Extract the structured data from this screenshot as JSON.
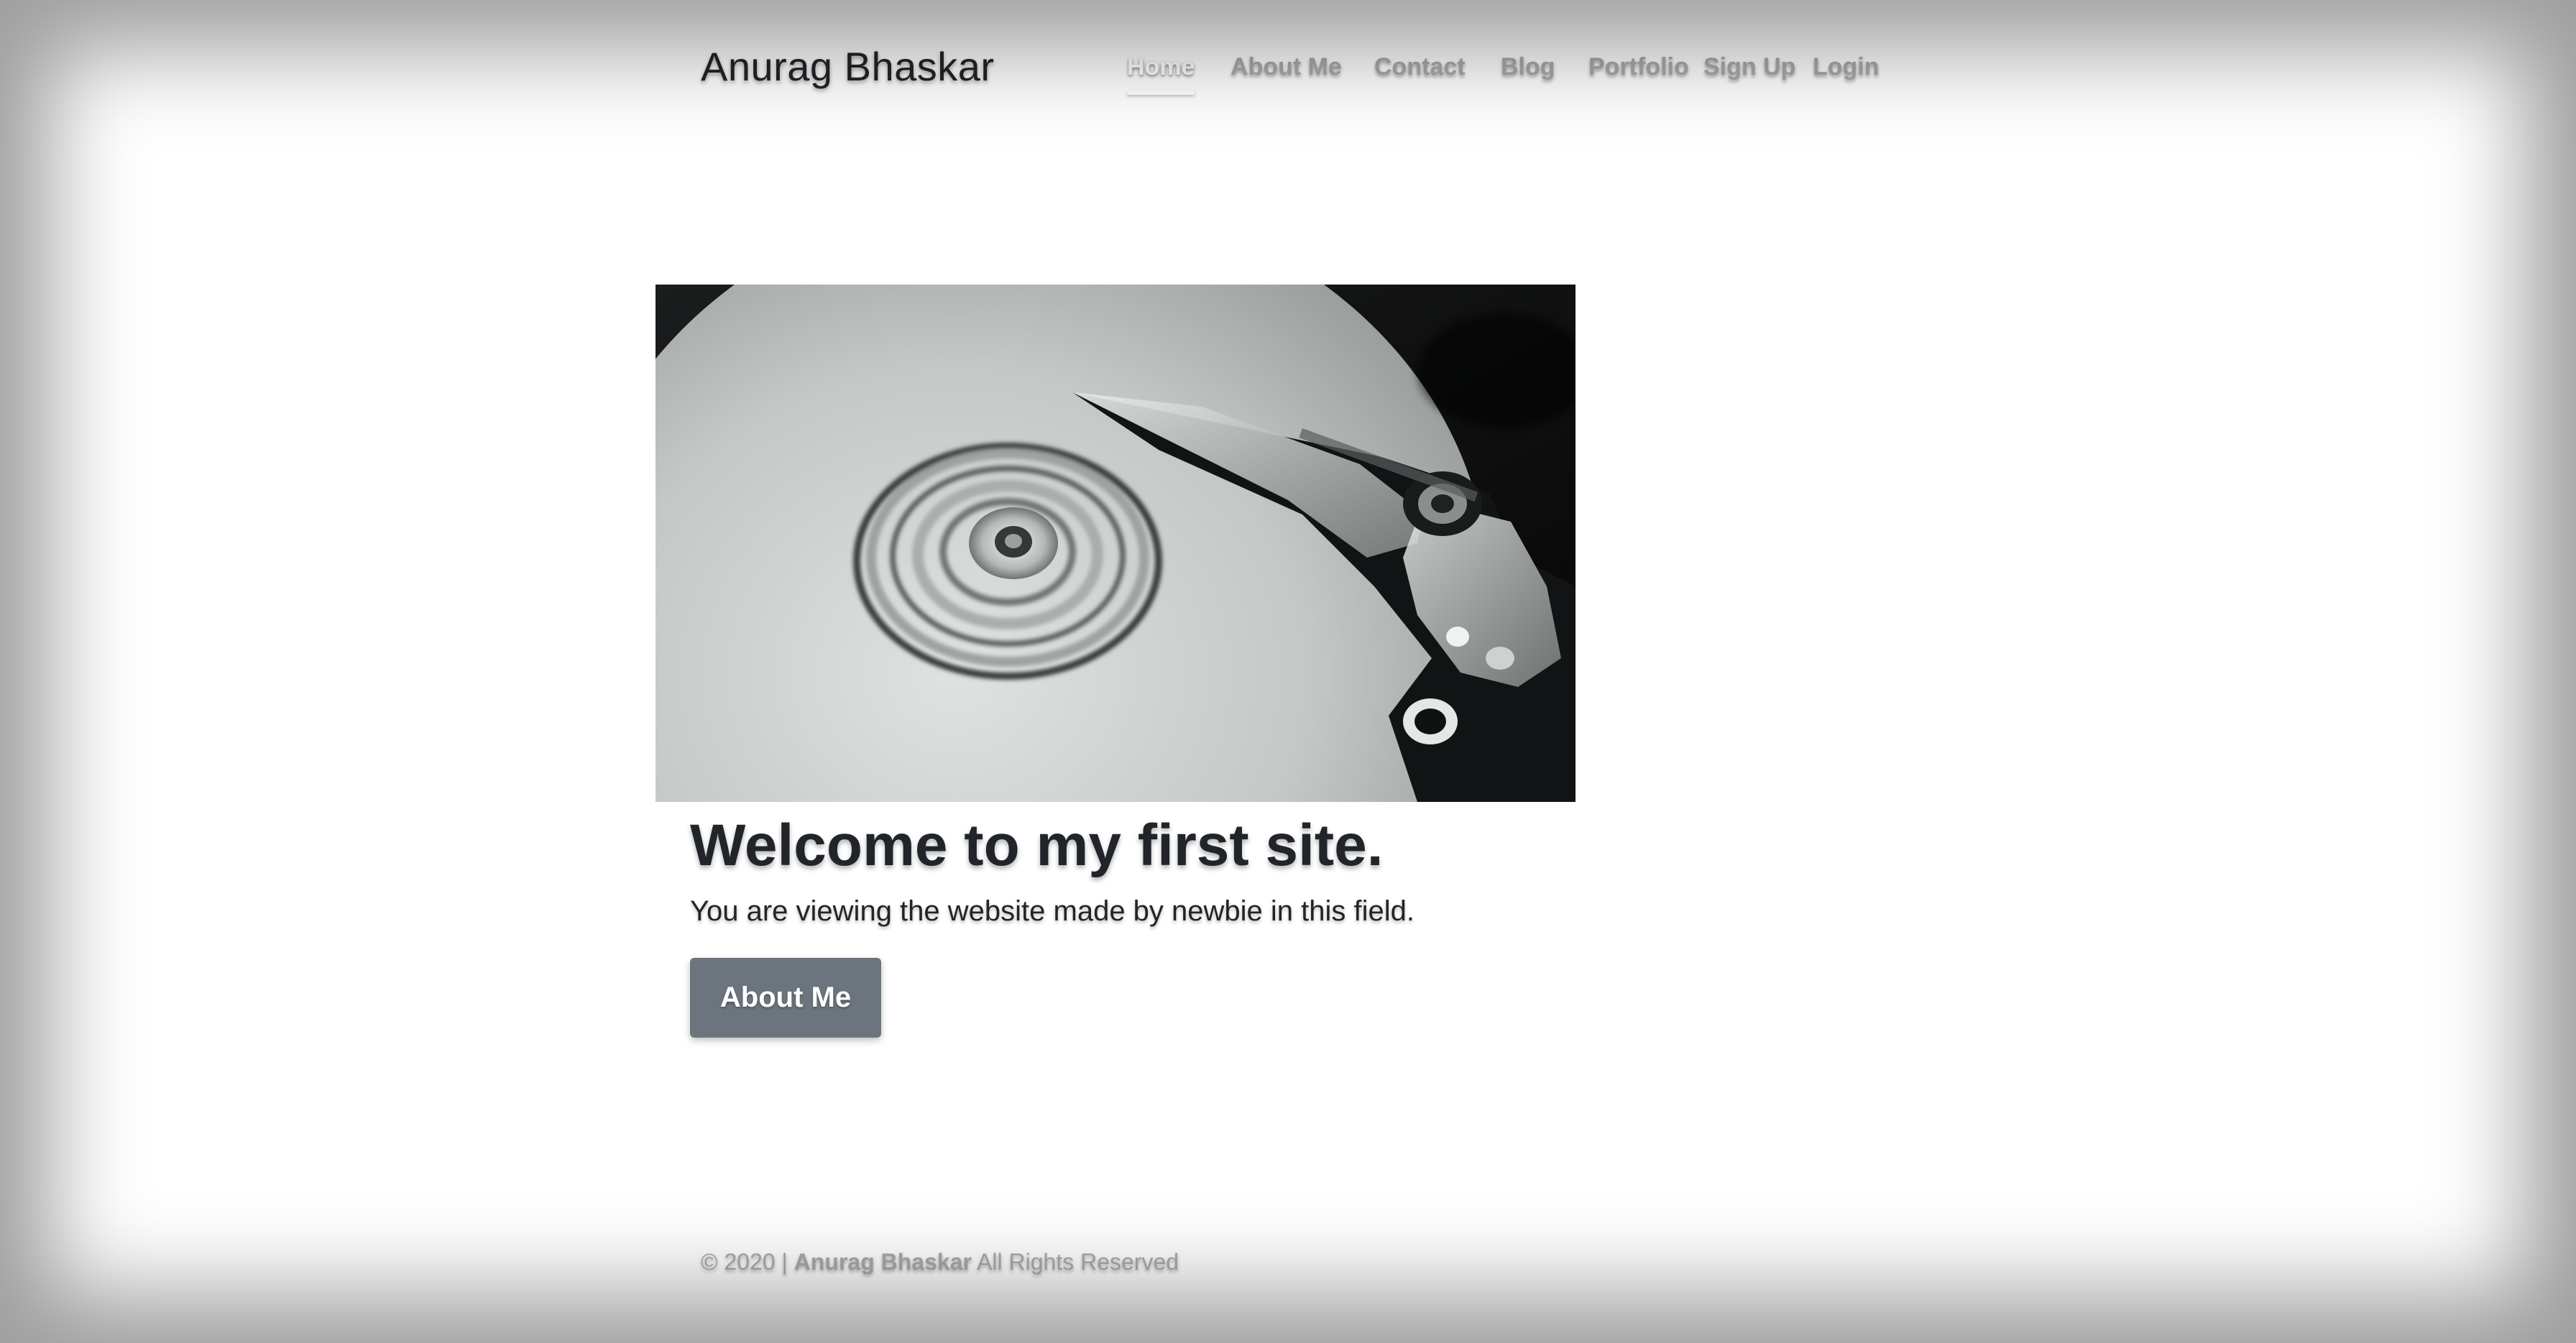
{
  "header": {
    "brand": "Anurag Bhaskar",
    "nav": [
      {
        "label": "Home",
        "active": true
      },
      {
        "label": "About Me",
        "active": false
      },
      {
        "label": "Contact",
        "active": false
      },
      {
        "label": "Blog",
        "active": false
      },
      {
        "label": "Portfolio",
        "active": false
      },
      {
        "label": "Sign Up",
        "active": false
      },
      {
        "label": "Login",
        "active": false
      }
    ]
  },
  "hero": {
    "headline": "Welcome to my first site.",
    "lead": "You are viewing the website made by newbie in this field.",
    "button_label": "About Me"
  },
  "footer": {
    "copyright": "© 2020 |",
    "owner": "Anurag Bhaskar",
    "rights": "All Rights Reserved"
  },
  "colors": {
    "button_bg": "#6c757d",
    "text_dark": "#212529",
    "nav_muted": "#a8aaad"
  }
}
